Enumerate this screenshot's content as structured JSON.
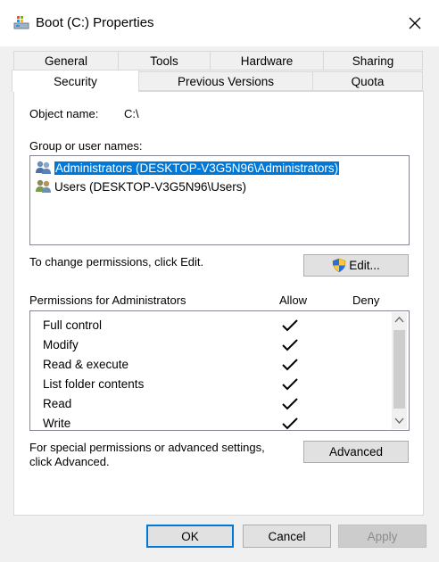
{
  "window": {
    "title": "Boot (C:) Properties",
    "close_icon": "close-icon"
  },
  "tabs": {
    "row1": [
      "General",
      "Tools",
      "Hardware",
      "Sharing"
    ],
    "row2": [
      "Security",
      "Previous Versions",
      "Quota"
    ],
    "active": "Security"
  },
  "security": {
    "object_name_label": "Object name:",
    "object_name_value": "C:\\",
    "group_label": "Group or user names:",
    "users": [
      {
        "name": "Administrators (DESKTOP-V3G5N96\\Administrators)",
        "selected": true
      },
      {
        "name": "Users (DESKTOP-V3G5N96\\Users)",
        "selected": false
      }
    ],
    "change_text": "To change permissions, click Edit.",
    "edit_button": "Edit...",
    "permissions_label": "Permissions for Administrators",
    "allow_header": "Allow",
    "deny_header": "Deny",
    "permissions": [
      {
        "name": "Full control",
        "allow": true,
        "deny": false
      },
      {
        "name": "Modify",
        "allow": true,
        "deny": false
      },
      {
        "name": "Read & execute",
        "allow": true,
        "deny": false
      },
      {
        "name": "List folder contents",
        "allow": true,
        "deny": false
      },
      {
        "name": "Read",
        "allow": true,
        "deny": false
      },
      {
        "name": "Write",
        "allow": true,
        "deny": false
      }
    ],
    "special_text_line1": "For special permissions or advanced settings,",
    "special_text_line2": "click Advanced.",
    "advanced_button": "Advanced"
  },
  "buttons": {
    "ok": "OK",
    "cancel": "Cancel",
    "apply": "Apply"
  },
  "colors": {
    "selection": "#0078d7",
    "window_bg": "#f0f0f0",
    "panel_bg": "#ffffff"
  }
}
